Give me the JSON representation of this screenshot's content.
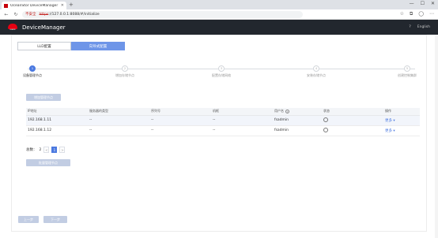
{
  "browser": {
    "tab_title": "OceanStor DeviceManager",
    "tab_close": "✕",
    "new_tab": "+",
    "security_warning": "不安全",
    "url_scheme": "https",
    "url_rest": "://127.0.0.1:8088/#/initialize",
    "controls": [
      "—",
      "☐",
      "✕"
    ]
  },
  "app": {
    "logo_text": "HUAWEI",
    "name": "DeviceManager",
    "help_icon": "?",
    "language": "English"
  },
  "tabs": [
    {
      "label": "LLD配置",
      "active": false
    },
    {
      "label": "向导式配置",
      "active": true
    }
  ],
  "steps": [
    {
      "num": "1",
      "label": "设备管理节点",
      "active": true
    },
    {
      "num": "2",
      "label": "增加存储节点",
      "active": false
    },
    {
      "num": "3",
      "label": "配置存储网络",
      "active": false
    },
    {
      "num": "4",
      "label": "安装存储节点",
      "active": false
    },
    {
      "num": "5",
      "label": "创建控制集群",
      "active": false
    }
  ],
  "add_node_button": "增加管理节点",
  "table": {
    "headers": [
      "IP地址",
      "服务器的类型",
      "序列号",
      "机框",
      "用户名",
      "状态",
      "操作"
    ],
    "rows": [
      {
        "ip": "192.168.1.11",
        "type": "--",
        "serial": "--",
        "chassis": "--",
        "user": "fsadmin",
        "more": "更多 ▾"
      },
      {
        "ip": "192.168.1.12",
        "type": "--",
        "serial": "--",
        "chassis": "--",
        "user": "fsadmin",
        "more": "更多 ▾"
      }
    ]
  },
  "pager": {
    "total_label": "总数：",
    "total": "2",
    "prev": "<",
    "page": "1",
    "next": ">"
  },
  "batch_button": "批量管理节点",
  "footer": {
    "prev": "上一步",
    "next": "下一步"
  }
}
